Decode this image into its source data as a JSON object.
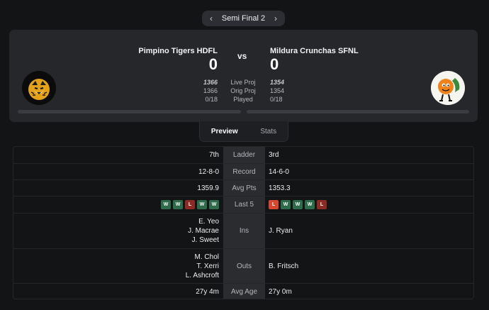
{
  "round": {
    "label": "Semi Final 2",
    "prev_icon": "chevron-left-icon",
    "next_icon": "chevron-right-icon"
  },
  "matchup": {
    "vs_label": "vs",
    "home": {
      "name": "Pimpino Tigers HDFL",
      "score": "0",
      "live_proj": "1366",
      "orig_proj": "1366",
      "played": "0/18",
      "played_fraction": 0
    },
    "away": {
      "name": "Mildura Crunchas SFNL",
      "score": "0",
      "live_proj": "1354",
      "orig_proj": "1354",
      "played": "0/18",
      "played_fraction": 0
    },
    "labels": {
      "live_proj": "Live Proj",
      "orig_proj": "Orig Proj",
      "played": "Played"
    }
  },
  "tabs": [
    {
      "label": "Preview",
      "active": true
    },
    {
      "label": "Stats",
      "active": false
    }
  ],
  "preview": {
    "ladder": {
      "label": "Ladder",
      "home": "7th",
      "away": "3rd"
    },
    "record": {
      "label": "Record",
      "home": "12-8-0",
      "away": "14-6-0"
    },
    "avg_pts": {
      "label": "Avg Pts",
      "home": "1359.9",
      "away": "1353.3"
    },
    "last5": {
      "label": "Last 5",
      "home": [
        "W",
        "W",
        "L",
        "W",
        "W"
      ],
      "away": [
        "L",
        "W",
        "W",
        "W",
        "L"
      ]
    },
    "ins": {
      "label": "Ins",
      "home": [
        "E. Yeo",
        "J. Macrae",
        "J. Sweet"
      ],
      "away": [
        "J. Ryan"
      ]
    },
    "outs": {
      "label": "Outs",
      "home": [
        "M. Chol",
        "T. Xerri",
        "L. Ashcroft"
      ],
      "away": [
        "B. Fritsch"
      ]
    },
    "avg_age": {
      "label": "Avg Age",
      "home": "27y 4m",
      "away": "27y 0m"
    }
  },
  "colors": {
    "win": "#2e6b4a",
    "loss": "#8c2a24",
    "latest_loss": "#d7472f",
    "card_bg": "#25272b",
    "page_bg": "#121416"
  }
}
